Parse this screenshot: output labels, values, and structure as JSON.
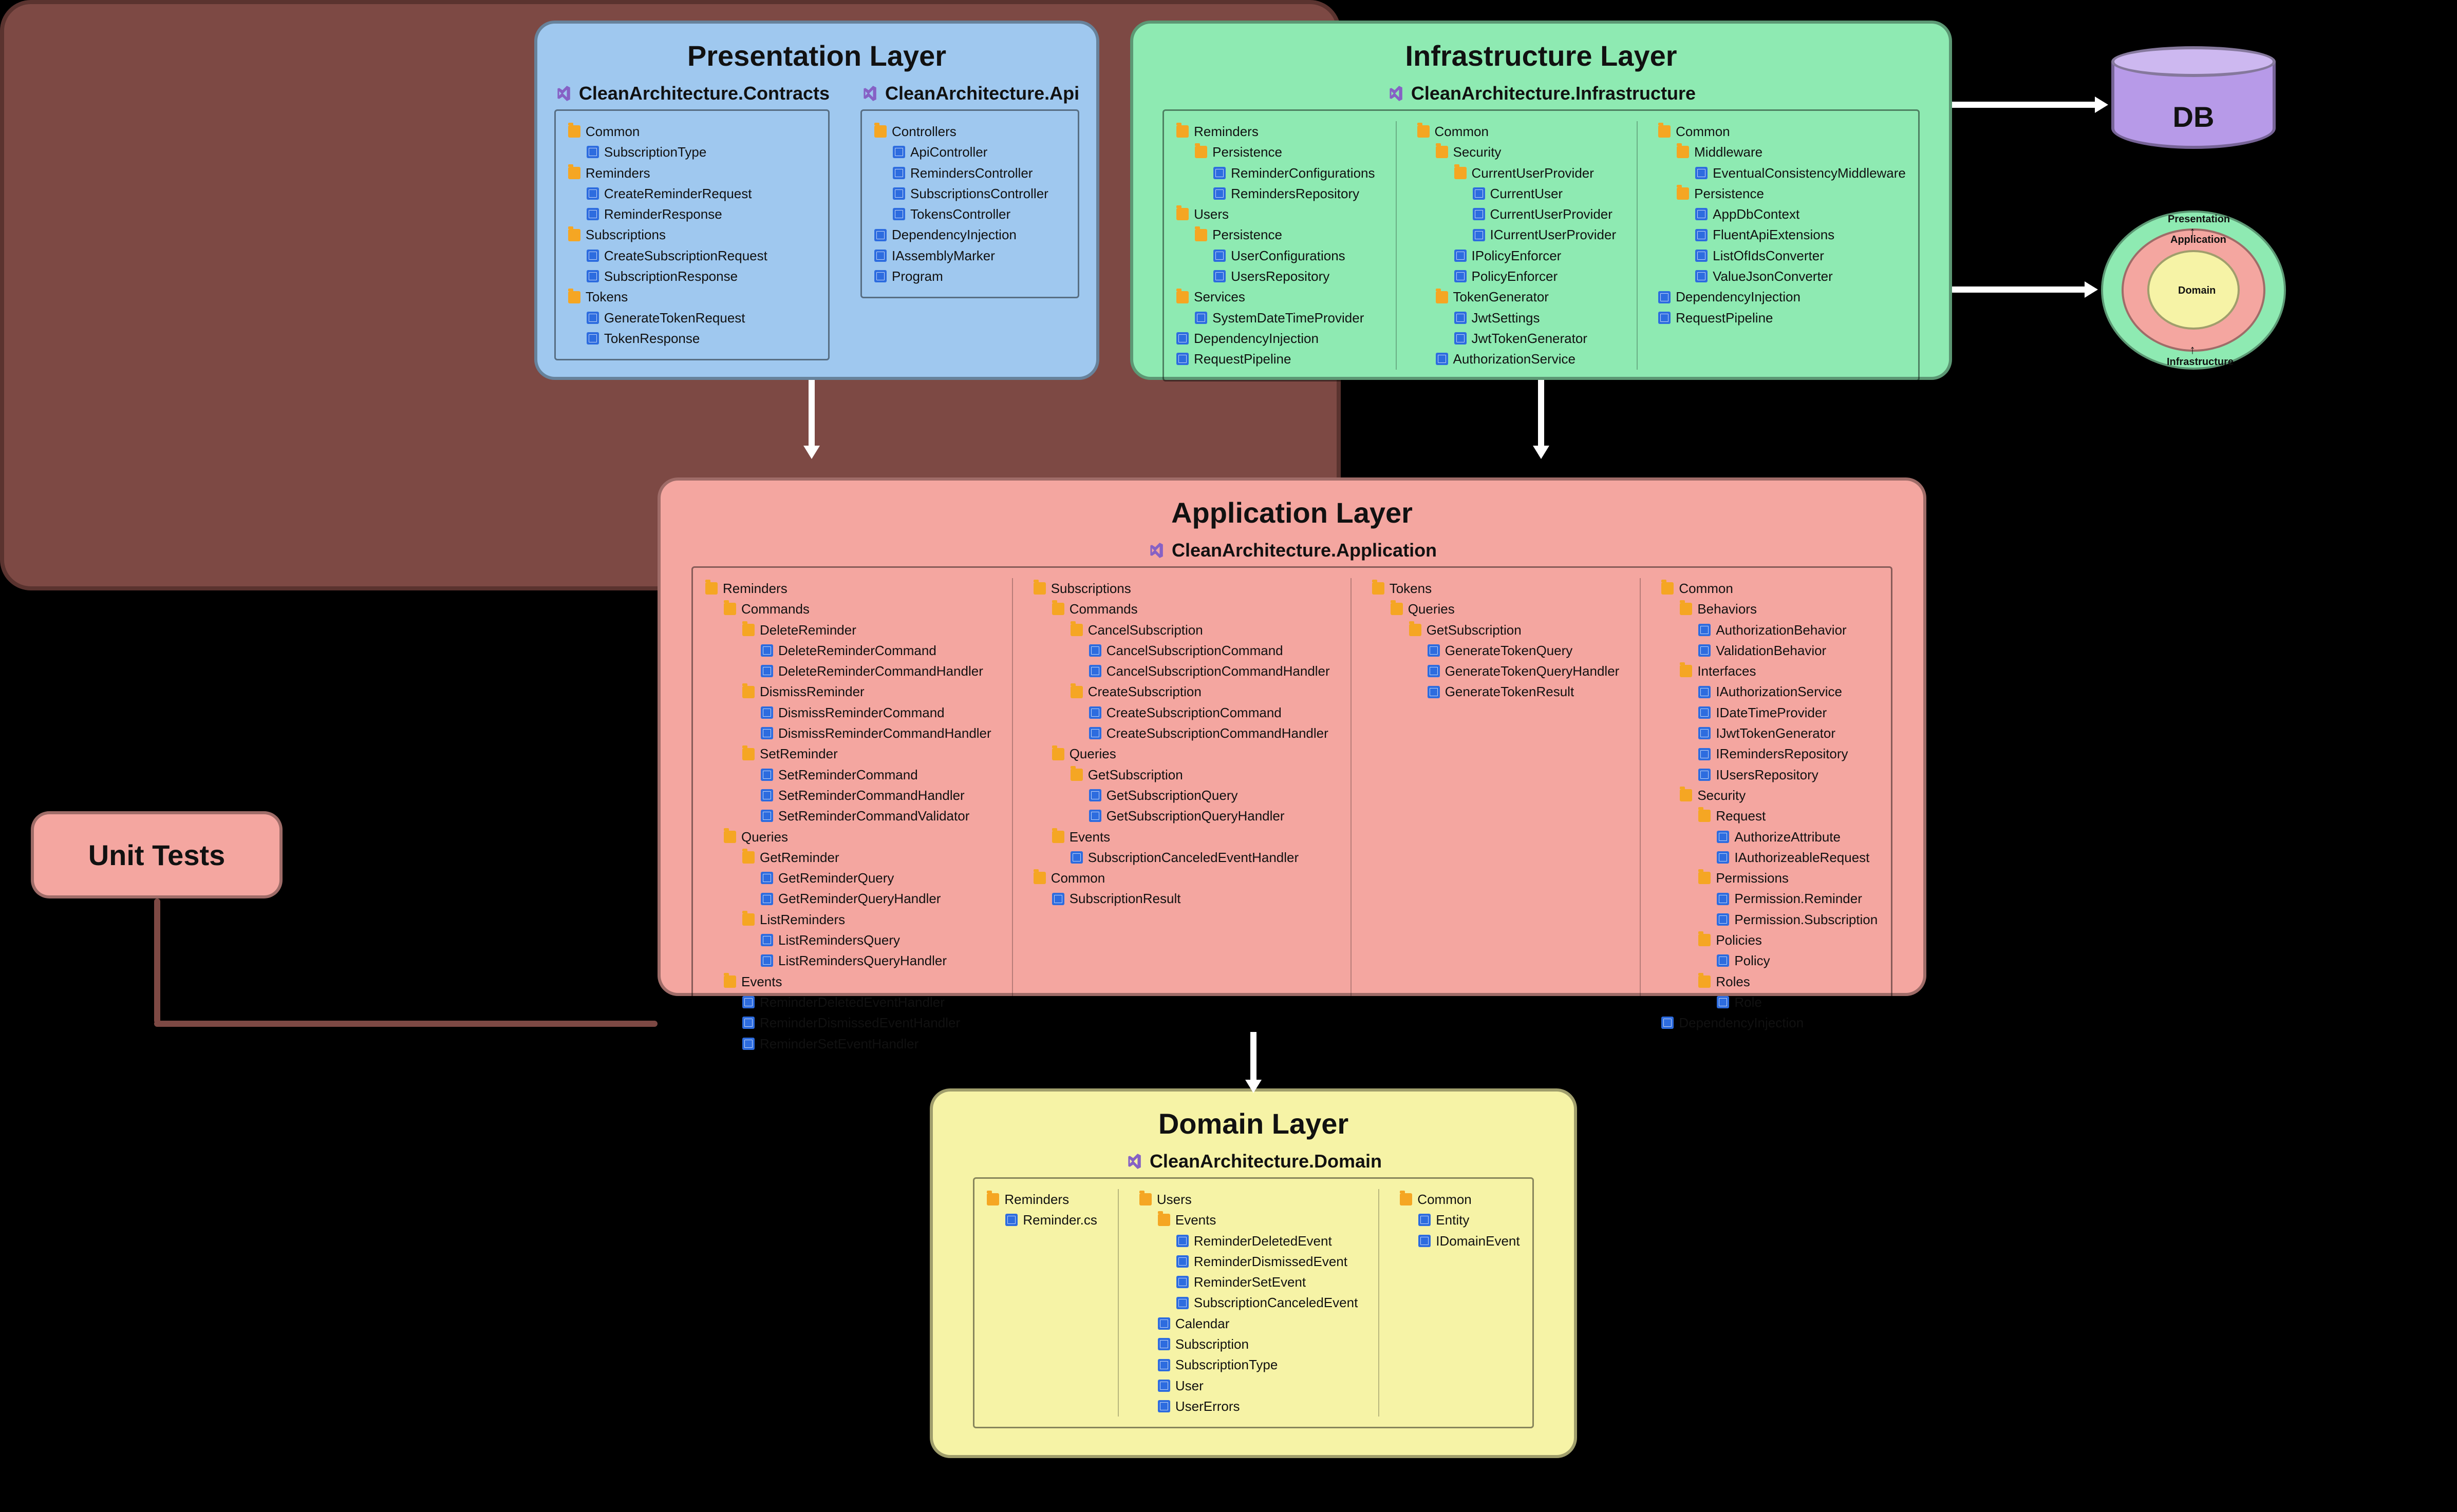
{
  "presentation": {
    "title": "Presentation Layer",
    "projects": [
      {
        "id": "contracts",
        "name": "CleanArchitecture.Contracts",
        "tree": [
          {
            "t": "folder",
            "l": "Common",
            "d": 0
          },
          {
            "t": "file",
            "l": "SubscriptionType",
            "d": 1
          },
          {
            "t": "folder",
            "l": "Reminders",
            "d": 0
          },
          {
            "t": "file",
            "l": "CreateReminderRequest",
            "d": 1
          },
          {
            "t": "file",
            "l": "ReminderResponse",
            "d": 1
          },
          {
            "t": "folder",
            "l": "Subscriptions",
            "d": 0
          },
          {
            "t": "file",
            "l": "CreateSubscriptionRequest",
            "d": 1
          },
          {
            "t": "file",
            "l": "SubscriptionResponse",
            "d": 1
          },
          {
            "t": "folder",
            "l": "Tokens",
            "d": 0
          },
          {
            "t": "file",
            "l": "GenerateTokenRequest",
            "d": 1
          },
          {
            "t": "file",
            "l": "TokenResponse",
            "d": 1
          }
        ]
      },
      {
        "id": "api",
        "name": "CleanArchitecture.Api",
        "tree": [
          {
            "t": "folder",
            "l": "Controllers",
            "d": 0
          },
          {
            "t": "file",
            "l": "ApiController",
            "d": 1
          },
          {
            "t": "file",
            "l": "RemindersController",
            "d": 1
          },
          {
            "t": "file",
            "l": "SubscriptionsController",
            "d": 1
          },
          {
            "t": "file",
            "l": "TokensController",
            "d": 1
          },
          {
            "t": "file",
            "l": "DependencyInjection",
            "d": 0
          },
          {
            "t": "file",
            "l": "IAssemblyMarker",
            "d": 0
          },
          {
            "t": "file",
            "l": "Program",
            "d": 0
          }
        ]
      }
    ]
  },
  "infrastructure": {
    "title": "Infrastructure Layer",
    "projects": [
      {
        "id": "infra",
        "name": "CleanArchitecture.Infrastructure",
        "columns": [
          [
            {
              "t": "folder",
              "l": "Reminders",
              "d": 0
            },
            {
              "t": "folder",
              "l": "Persistence",
              "d": 1
            },
            {
              "t": "file",
              "l": "ReminderConfigurations",
              "d": 2
            },
            {
              "t": "file",
              "l": "RemindersRepository",
              "d": 2
            },
            {
              "t": "folder",
              "l": "Users",
              "d": 0
            },
            {
              "t": "folder",
              "l": "Persistence",
              "d": 1
            },
            {
              "t": "file",
              "l": "UserConfigurations",
              "d": 2
            },
            {
              "t": "file",
              "l": "UsersRepository",
              "d": 2
            },
            {
              "t": "folder",
              "l": "Services",
              "d": 0
            },
            {
              "t": "file",
              "l": "SystemDateTimeProvider",
              "d": 1
            },
            {
              "t": "file",
              "l": "DependencyInjection",
              "d": 0
            },
            {
              "t": "file",
              "l": "RequestPipeline",
              "d": 0
            }
          ],
          [
            {
              "t": "folder",
              "l": "Common",
              "d": 0
            },
            {
              "t": "folder",
              "l": "Security",
              "d": 1
            },
            {
              "t": "folder",
              "l": "CurrentUserProvider",
              "d": 2
            },
            {
              "t": "file",
              "l": "CurrentUser",
              "d": 3
            },
            {
              "t": "file",
              "l": "CurrentUserProvider",
              "d": 3
            },
            {
              "t": "file",
              "l": "ICurrentUserProvider",
              "d": 3
            },
            {
              "t": "file",
              "l": "IPolicyEnforcer",
              "d": 2
            },
            {
              "t": "file",
              "l": "PolicyEnforcer",
              "d": 2
            },
            {
              "t": "folder",
              "l": "TokenGenerator",
              "d": 1
            },
            {
              "t": "file",
              "l": "JwtSettings",
              "d": 2
            },
            {
              "t": "file",
              "l": "JwtTokenGenerator",
              "d": 2
            },
            {
              "t": "file",
              "l": "AuthorizationService",
              "d": 1
            }
          ],
          [
            {
              "t": "folder",
              "l": "Common",
              "d": 0
            },
            {
              "t": "folder",
              "l": "Middleware",
              "d": 1
            },
            {
              "t": "file",
              "l": "EventualConsistencyMiddleware",
              "d": 2
            },
            {
              "t": "folder",
              "l": "Persistence",
              "d": 1
            },
            {
              "t": "file",
              "l": "AppDbContext",
              "d": 2
            },
            {
              "t": "file",
              "l": "FluentApiExtensions",
              "d": 2
            },
            {
              "t": "file",
              "l": "ListOfIdsConverter",
              "d": 2
            },
            {
              "t": "file",
              "l": "ValueJsonConverter",
              "d": 2
            },
            {
              "t": "file",
              "l": "DependencyInjection",
              "d": 0
            },
            {
              "t": "file",
              "l": "RequestPipeline",
              "d": 0
            }
          ]
        ]
      }
    ]
  },
  "application": {
    "title": "Application Layer",
    "projects": [
      {
        "id": "app",
        "name": "CleanArchitecture.Application",
        "columns": [
          [
            {
              "t": "folder",
              "l": "Reminders",
              "d": 0
            },
            {
              "t": "folder",
              "l": "Commands",
              "d": 1
            },
            {
              "t": "folder",
              "l": "DeleteReminder",
              "d": 2
            },
            {
              "t": "file",
              "l": "DeleteReminderCommand",
              "d": 3
            },
            {
              "t": "file",
              "l": "DeleteReminderCommandHandler",
              "d": 3
            },
            {
              "t": "folder",
              "l": "DismissReminder",
              "d": 2
            },
            {
              "t": "file",
              "l": "DismissReminderCommand",
              "d": 3
            },
            {
              "t": "file",
              "l": "DismissReminderCommandHandler",
              "d": 3
            },
            {
              "t": "folder",
              "l": "SetReminder",
              "d": 2
            },
            {
              "t": "file",
              "l": "SetReminderCommand",
              "d": 3
            },
            {
              "t": "file",
              "l": "SetReminderCommandHandler",
              "d": 3
            },
            {
              "t": "file",
              "l": "SetReminderCommandValidator",
              "d": 3
            },
            {
              "t": "folder",
              "l": "Queries",
              "d": 1
            },
            {
              "t": "folder",
              "l": "GetReminder",
              "d": 2
            },
            {
              "t": "file",
              "l": "GetReminderQuery",
              "d": 3
            },
            {
              "t": "file",
              "l": "GetReminderQueryHandler",
              "d": 3
            },
            {
              "t": "folder",
              "l": "ListReminders",
              "d": 2
            },
            {
              "t": "file",
              "l": "ListRemindersQuery",
              "d": 3
            },
            {
              "t": "file",
              "l": "ListRemindersQueryHandler",
              "d": 3
            },
            {
              "t": "folder",
              "l": "Events",
              "d": 1
            },
            {
              "t": "file",
              "l": "ReminderDeletedEventHandler",
              "d": 2
            },
            {
              "t": "file",
              "l": "ReminderDismissedEventHandler",
              "d": 2
            },
            {
              "t": "file",
              "l": "ReminderSetEventHandler",
              "d": 2
            }
          ],
          [
            {
              "t": "folder",
              "l": "Subscriptions",
              "d": 0
            },
            {
              "t": "folder",
              "l": "Commands",
              "d": 1
            },
            {
              "t": "folder",
              "l": "CancelSubscription",
              "d": 2
            },
            {
              "t": "file",
              "l": "CancelSubscriptionCommand",
              "d": 3
            },
            {
              "t": "file",
              "l": "CancelSubscriptionCommandHandler",
              "d": 3
            },
            {
              "t": "folder",
              "l": "CreateSubscription",
              "d": 2
            },
            {
              "t": "file",
              "l": "CreateSubscriptionCommand",
              "d": 3
            },
            {
              "t": "file",
              "l": "CreateSubscriptionCommandHandler",
              "d": 3
            },
            {
              "t": "folder",
              "l": "Queries",
              "d": 1
            },
            {
              "t": "folder",
              "l": "GetSubscription",
              "d": 2
            },
            {
              "t": "file",
              "l": "GetSubscriptionQuery",
              "d": 3
            },
            {
              "t": "file",
              "l": "GetSubscriptionQueryHandler",
              "d": 3
            },
            {
              "t": "folder",
              "l": "Events",
              "d": 1
            },
            {
              "t": "file",
              "l": "SubscriptionCanceledEventHandler",
              "d": 2
            },
            {
              "t": "folder",
              "l": "Common",
              "d": 0
            },
            {
              "t": "file",
              "l": "SubscriptionResult",
              "d": 1
            }
          ],
          [
            {
              "t": "folder",
              "l": "Tokens",
              "d": 0
            },
            {
              "t": "folder",
              "l": "Queries",
              "d": 1
            },
            {
              "t": "folder",
              "l": "GetSubscription",
              "d": 2
            },
            {
              "t": "file",
              "l": "GenerateTokenQuery",
              "d": 3
            },
            {
              "t": "file",
              "l": "GenerateTokenQueryHandler",
              "d": 3
            },
            {
              "t": "file",
              "l": "GenerateTokenResult",
              "d": 3
            }
          ],
          [
            {
              "t": "folder",
              "l": "Common",
              "d": 0
            },
            {
              "t": "folder",
              "l": "Behaviors",
              "d": 1
            },
            {
              "t": "file",
              "l": "AuthorizationBehavior",
              "d": 2
            },
            {
              "t": "file",
              "l": "ValidationBehavior",
              "d": 2
            },
            {
              "t": "folder",
              "l": "Interfaces",
              "d": 1
            },
            {
              "t": "file",
              "l": "IAuthorizationService",
              "d": 2
            },
            {
              "t": "file",
              "l": "IDateTimeProvider",
              "d": 2
            },
            {
              "t": "file",
              "l": "IJwtTokenGenerator",
              "d": 2
            },
            {
              "t": "file",
              "l": "IRemindersRepository",
              "d": 2
            },
            {
              "t": "file",
              "l": "IUsersRepository",
              "d": 2
            },
            {
              "t": "folder",
              "l": "Security",
              "d": 1
            },
            {
              "t": "folder",
              "l": "Request",
              "d": 2
            },
            {
              "t": "file",
              "l": "AuthorizeAttribute",
              "d": 3
            },
            {
              "t": "file",
              "l": "IAuthorizeableRequest",
              "d": 3
            },
            {
              "t": "folder",
              "l": "Permissions",
              "d": 2
            },
            {
              "t": "file",
              "l": "Permission.Reminder",
              "d": 3
            },
            {
              "t": "file",
              "l": "Permission.Subscription",
              "d": 3
            },
            {
              "t": "folder",
              "l": "Policies",
              "d": 2
            },
            {
              "t": "file",
              "l": "Policy",
              "d": 3
            },
            {
              "t": "folder",
              "l": "Roles",
              "d": 2
            },
            {
              "t": "file",
              "l": "Role",
              "d": 3
            },
            {
              "t": "file",
              "l": "DependencyInjection",
              "d": 0
            }
          ]
        ]
      }
    ]
  },
  "domain": {
    "title": "Domain Layer",
    "projects": [
      {
        "id": "dom",
        "name": "CleanArchitecture.Domain",
        "columns": [
          [
            {
              "t": "folder",
              "l": "Reminders",
              "d": 0
            },
            {
              "t": "file",
              "l": "Reminder.cs",
              "d": 1
            }
          ],
          [
            {
              "t": "folder",
              "l": "Users",
              "d": 0
            },
            {
              "t": "folder",
              "l": "Events",
              "d": 1
            },
            {
              "t": "file",
              "l": "ReminderDeletedEvent",
              "d": 2
            },
            {
              "t": "file",
              "l": "ReminderDismissedEvent",
              "d": 2
            },
            {
              "t": "file",
              "l": "ReminderSetEvent",
              "d": 2
            },
            {
              "t": "file",
              "l": "SubscriptionCanceledEvent",
              "d": 2
            },
            {
              "t": "file",
              "l": "Calendar",
              "d": 1
            },
            {
              "t": "file",
              "l": "Subscription",
              "d": 1
            },
            {
              "t": "file",
              "l": "SubscriptionType",
              "d": 1
            },
            {
              "t": "file",
              "l": "User",
              "d": 1
            },
            {
              "t": "file",
              "l": "UserErrors",
              "d": 1
            }
          ],
          [
            {
              "t": "folder",
              "l": "Common",
              "d": 0
            },
            {
              "t": "file",
              "l": "Entity",
              "d": 1
            },
            {
              "t": "file",
              "l": "IDomainEvent",
              "d": 1
            }
          ]
        ]
      }
    ]
  },
  "unit_tests": {
    "label": "Unit Tests"
  },
  "db": {
    "label": "DB"
  },
  "onion": {
    "ring1": "Presentation",
    "ring1b": "Infrastructure",
    "ring2": "Application",
    "ring3": "Domain"
  }
}
